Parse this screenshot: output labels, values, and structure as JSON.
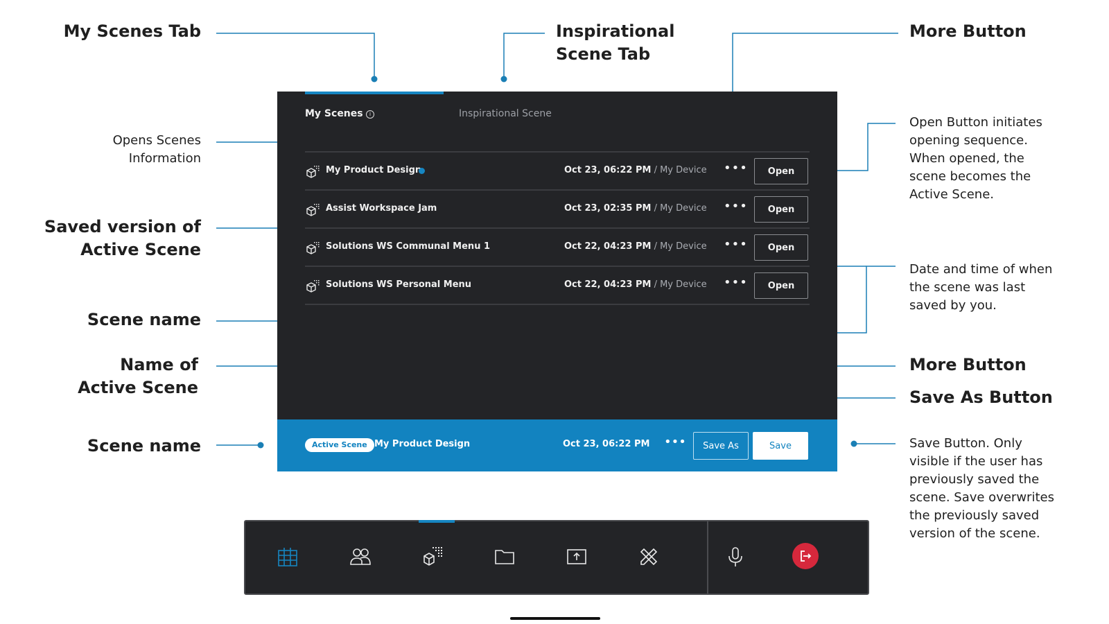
{
  "labels": {
    "my_scenes_tab": "My Scenes Tab",
    "inspirational_scene_tab": "Inspirational\nScene Tab",
    "more_button_top": "More Button",
    "opens_scenes_information": "Opens Scenes\nInformation",
    "open_button_desc": "Open Button initiates\nopening sequence.\nWhen opened, the\nscene becomes the\nActive Scene.",
    "saved_version": "Saved version of\nActive Scene",
    "date_time_desc": "Date and time of when\nthe scene was last\nsaved by you.",
    "scene_name_1": "Scene name",
    "name_of_active_scene": "Name of\nActive Scene",
    "more_button_bottom": "More Button",
    "save_as_button": "Save As Button",
    "scene_name_2": "Scene name",
    "save_button_desc": "Save Button. Only\nvisible if the user has\npreviously saved the\nscene. Save overwrites\nthe previously saved\nversion of the scene."
  },
  "panel": {
    "tabs": [
      {
        "label": "My Scenes",
        "active": true
      },
      {
        "label": "Inspirational Scene",
        "active": false
      }
    ],
    "rows": [
      {
        "name": "My Product Design",
        "date": "Oct 23, 06:22 PM",
        "device": "My Device",
        "open_label": "Open",
        "active_marker": true
      },
      {
        "name": "Assist Workspace Jam",
        "date": "Oct 23, 02:35 PM",
        "device": "My Device",
        "open_label": "Open",
        "active_marker": false
      },
      {
        "name": "Solutions WS Communal Menu 1",
        "date": "Oct 22, 04:23 PM",
        "device": "My Device",
        "open_label": "Open",
        "active_marker": false
      },
      {
        "name": "Solutions WS Personal Menu",
        "date": "Oct 22, 04:23 PM",
        "device": "My Device",
        "open_label": "Open",
        "active_marker": false
      }
    ],
    "more_glyph": "•••",
    "device_separator": " / ",
    "active_bar": {
      "badge": "Active Scene",
      "name": "My Product Design",
      "date": "Oct 23, 06:22 PM",
      "more_glyph": "•••",
      "save_as_label": "Save As",
      "save_label": "Save"
    }
  },
  "toolbar": {
    "icons": [
      "grid-icon",
      "people-icon",
      "scenes-icon",
      "folder-icon",
      "share-screen-icon",
      "tools-icon",
      "microphone-icon",
      "leave-icon"
    ]
  },
  "colors": {
    "accent": "#1686c2",
    "panel_bg": "#232427",
    "active_bar_bg": "#1283c0",
    "leave_red": "#d6283c",
    "line_blue": "#1a7fb5"
  }
}
